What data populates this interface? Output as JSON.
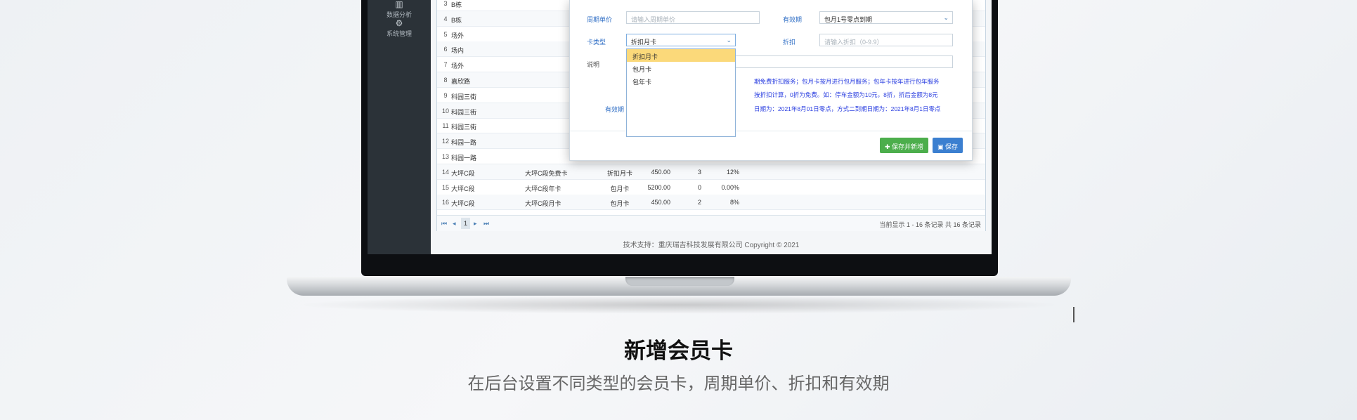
{
  "sidebar": {
    "items": [
      {
        "label": "数据分析",
        "icon": "chart-icon"
      },
      {
        "label": "系统管理",
        "icon": "gear-icon"
      }
    ]
  },
  "table": {
    "rows": [
      {
        "num": "3",
        "c1": "B栋",
        "c2": "",
        "c3": "",
        "c4": "",
        "c5": "",
        "c6": ""
      },
      {
        "num": "4",
        "c1": "B栋",
        "c2": "",
        "c3": "",
        "c4": "",
        "c5": "",
        "c6": ""
      },
      {
        "num": "5",
        "c1": "场外",
        "c2": "",
        "c3": "",
        "c4": "",
        "c5": "",
        "c6": ""
      },
      {
        "num": "6",
        "c1": "场内",
        "c2": "",
        "c3": "",
        "c4": "",
        "c5": "",
        "c6": ""
      },
      {
        "num": "7",
        "c1": "场外",
        "c2": "",
        "c3": "",
        "c4": "",
        "c5": "",
        "c6": ""
      },
      {
        "num": "8",
        "c1": "嘉欣路",
        "c2": "",
        "c3": "",
        "c4": "",
        "c5": "",
        "c6": ""
      },
      {
        "num": "9",
        "c1": "科园三街",
        "c2": "",
        "c3": "",
        "c4": "",
        "c5": "",
        "c6": ""
      },
      {
        "num": "10",
        "c1": "科园三街",
        "c2": "",
        "c3": "",
        "c4": "",
        "c5": "",
        "c6": ""
      },
      {
        "num": "11",
        "c1": "科园三街",
        "c2": "",
        "c3": "",
        "c4": "",
        "c5": "",
        "c6": ""
      },
      {
        "num": "12",
        "c1": "科园一路",
        "c2": "",
        "c3": "",
        "c4": "",
        "c5": "",
        "c6": ""
      },
      {
        "num": "13",
        "c1": "科园一路",
        "c2": "",
        "c3": "",
        "c4": "",
        "c5": "",
        "c6": ""
      },
      {
        "num": "14",
        "c1": "大坪C段",
        "c2": "大坪C段免费卡",
        "c3": "折扣月卡",
        "c4": "450.00",
        "c5": "3",
        "c6": "12%"
      },
      {
        "num": "15",
        "c1": "大坪C段",
        "c2": "大坪C段年卡",
        "c3": "包月卡",
        "c4": "5200.00",
        "c5": "0",
        "c6": "0.00%"
      },
      {
        "num": "16",
        "c1": "大坪C段",
        "c2": "大坪C段月卡",
        "c3": "包月卡",
        "c4": "450.00",
        "c5": "2",
        "c6": "8%"
      }
    ]
  },
  "pager": {
    "first": "⏮",
    "prev": "◂",
    "page": "1",
    "next": "▸",
    "last": "⏭",
    "summary": "当前显示 1 - 16 条记录 共 16 条记录"
  },
  "footer": {
    "text": "技术支持：重庆瑞吉科技发展有限公司 Copyright © 2021"
  },
  "modal": {
    "period_price_label": "周期单价",
    "period_price_placeholder": "请输入周期单价",
    "validity_label": "有效期",
    "validity_value": "包月1号零点到期",
    "card_type_label": "卡类型",
    "card_type_value": "折扣月卡",
    "discount_label": "折扣",
    "discount_placeholder": "请输入折扣（0-9.9）",
    "desc_label": "说明",
    "validity_label2": "有效期",
    "note1": "期免费折扣服务；包月卡按月进行包月服务；包年卡按年进行包年服务",
    "note2": "按折扣计算，0折为免费。如：停车金额为10元，8折，折后金额为8元",
    "note3": "日期为：2021年8月01日零点，方式二到期日期为：2021年8月1日零点",
    "dropdown_options": [
      "折扣月卡",
      "包月卡",
      "包年卡"
    ],
    "save_new_label": "✚ 保存并新增",
    "save_label": "▣ 保存"
  },
  "caption": {
    "title": "新增会员卡",
    "subtitle": "在后台设置不同类型的会员卡，周期单价、折扣和有效期"
  }
}
